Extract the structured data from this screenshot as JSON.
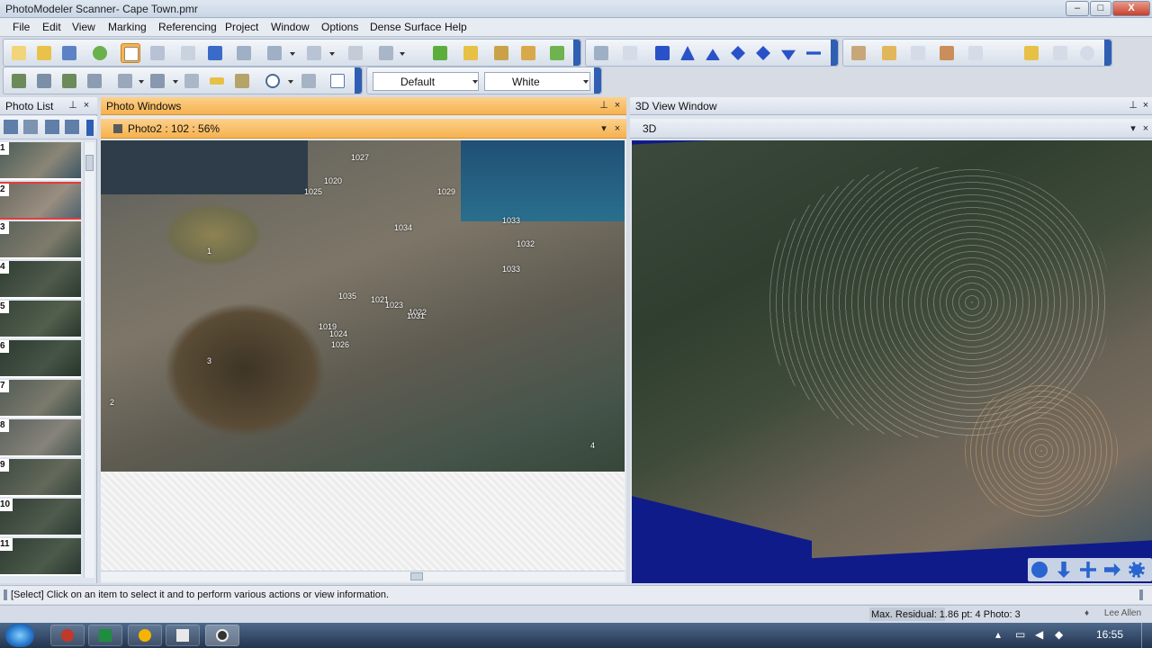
{
  "window": {
    "title": "PhotoModeler Scanner- Cape Town.pmr",
    "min_label": "–",
    "max_label": "□",
    "close_label": "X"
  },
  "menu": {
    "items": [
      "File",
      "Edit",
      "View",
      "Marking",
      "Referencing",
      "Project",
      "Window",
      "Options",
      "Dense Surface",
      "Help"
    ]
  },
  "toolbar": {
    "combo_default": "Default",
    "combo_white": "White"
  },
  "photo_list": {
    "title": "Photo List",
    "pin": "📌",
    "close": "×",
    "thumbs": [
      "1",
      "2",
      "3",
      "4",
      "5",
      "6",
      "7",
      "8",
      "9",
      "10",
      "11"
    ]
  },
  "photo_windows": {
    "title": "Photo Windows",
    "tab_label": "Photo2 : 102 : 56%",
    "points": [
      "1027",
      "1025",
      "1020",
      "1029",
      "1033",
      "1034",
      "1032",
      "1033",
      "1035",
      "1021",
      "1023",
      "1022",
      "1019",
      "1024",
      "1026",
      "3",
      "2",
      "1",
      "4",
      "1031"
    ]
  },
  "view3d": {
    "title": "3D View Window",
    "tab_label": "3D"
  },
  "status": {
    "text": "[Select] Click on an item to select it and to perform various actions or view information.",
    "residual_label": "Max. Residual: 1.86 pt: 4 Photo: 3",
    "time": "16:55",
    "user": "Lee Allen"
  },
  "colors": {
    "accent_orange": "#f6b24f",
    "toolbar_grip": "#2f5fb3",
    "hot_button": "#f9b44a"
  }
}
